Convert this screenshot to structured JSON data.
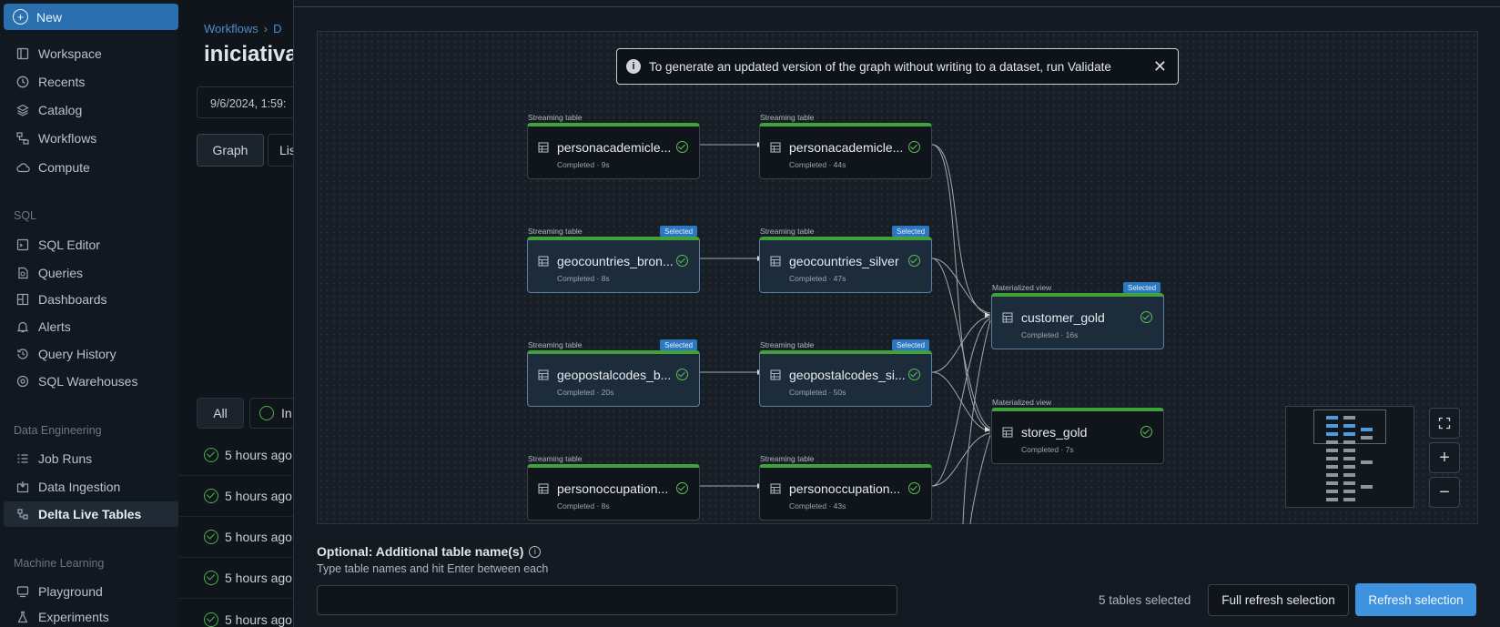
{
  "sidebar": {
    "new_label": "New",
    "items": [
      {
        "label": "Workspace",
        "icon": "workspace-icon"
      },
      {
        "label": "Recents",
        "icon": "clock-icon"
      },
      {
        "label": "Catalog",
        "icon": "catalog-icon"
      },
      {
        "label": "Workflows",
        "icon": "workflows-icon"
      },
      {
        "label": "Compute",
        "icon": "cloud-icon"
      }
    ],
    "sql_section": "SQL",
    "sql_items": [
      {
        "label": "SQL Editor",
        "icon": "sql-editor-icon"
      },
      {
        "label": "Queries",
        "icon": "queries-icon"
      },
      {
        "label": "Dashboards",
        "icon": "dashboards-icon"
      },
      {
        "label": "Alerts",
        "icon": "bell-icon"
      },
      {
        "label": "Query History",
        "icon": "history-icon"
      },
      {
        "label": "SQL Warehouses",
        "icon": "warehouse-icon"
      }
    ],
    "de_section": "Data Engineering",
    "de_items": [
      {
        "label": "Job Runs",
        "icon": "job-runs-icon"
      },
      {
        "label": "Data Ingestion",
        "icon": "ingestion-icon"
      },
      {
        "label": "Delta Live Tables",
        "icon": "dlt-icon"
      }
    ],
    "ml_section": "Machine Learning",
    "ml_items": [
      {
        "label": "Playground",
        "icon": "playground-icon"
      },
      {
        "label": "Experiments",
        "icon": "experiments-icon"
      }
    ]
  },
  "background": {
    "breadcrumb_1": "Workflows",
    "breadcrumb_2": "D",
    "title": "iniciativa_",
    "date": "9/6/2024, 1:59:",
    "tab_graph": "Graph",
    "tab_list": "Lis",
    "filter_all": "All",
    "filter_second": "In",
    "runs": [
      "5 hours ago",
      "5 hours ago",
      "5 hours ago",
      "5 hours ago",
      "5 hours ago"
    ]
  },
  "modal": {
    "banner_text": "To generate an updated version of the graph without writing to a dataset, run Validate",
    "selected_badge": "Selected",
    "nodes": [
      {
        "type": "Streaming table",
        "name": "personacademicle...",
        "status": "Completed · 9s",
        "selected": false
      },
      {
        "type": "Streaming table",
        "name": "personacademicle...",
        "status": "Completed · 44s",
        "selected": false
      },
      {
        "type": "Streaming table",
        "name": "geocountries_bron...",
        "status": "Completed · 8s",
        "selected": true
      },
      {
        "type": "Streaming table",
        "name": "geocountries_silver",
        "status": "Completed · 47s",
        "selected": true
      },
      {
        "type": "Streaming table",
        "name": "geopostalcodes_b...",
        "status": "Completed · 20s",
        "selected": true
      },
      {
        "type": "Streaming table",
        "name": "geopostalcodes_si...",
        "status": "Completed · 50s",
        "selected": true
      },
      {
        "type": "Streaming table",
        "name": "personoccupation...",
        "status": "Completed · 8s",
        "selected": false
      },
      {
        "type": "Streaming table",
        "name": "personoccupation...",
        "status": "Completed · 43s",
        "selected": false
      },
      {
        "type": "Materialized view",
        "name": "customer_gold",
        "status": "Completed · 16s",
        "selected": true
      },
      {
        "type": "Materialized view",
        "name": "stores_gold",
        "status": "Completed · 7s",
        "selected": false
      }
    ],
    "optional_label": "Optional: Additional table name(s)",
    "optional_help": "Type table names and hit Enter between each",
    "optional_value": "",
    "selected_count": "5 tables selected",
    "full_refresh_label": "Full refresh selection",
    "refresh_label": "Refresh selection",
    "colors": {
      "accent": "#3f92de",
      "success": "#3fa23a",
      "selected_badge": "#2b77c1"
    }
  }
}
